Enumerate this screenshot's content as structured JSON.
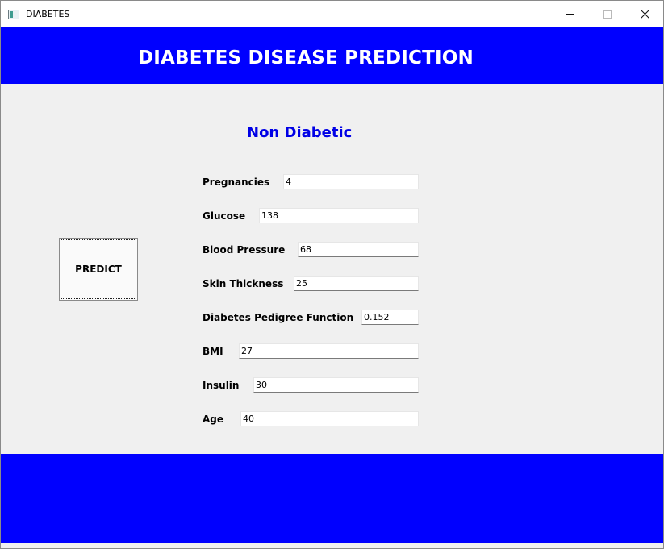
{
  "window": {
    "title": "DIABETES",
    "icon": "app-window-icon",
    "controls": {
      "minimize": "minimize-icon",
      "maximize": "maximize-icon",
      "close": "close-icon"
    }
  },
  "header": {
    "title": "DIABETES DISEASE PREDICTION",
    "band_color": "#0000ff"
  },
  "result": {
    "text": "Non Diabetic",
    "color": "#0000e6"
  },
  "predict_button": {
    "label": "PREDICT"
  },
  "fields": [
    {
      "label": "Pregnancies",
      "value": "4"
    },
    {
      "label": "Glucose",
      "value": "138"
    },
    {
      "label": "Blood Pressure",
      "value": "68"
    },
    {
      "label": "Skin Thickness",
      "value": "25"
    },
    {
      "label": "Diabetes Pedigree Function",
      "value": "0.152"
    },
    {
      "label": "BMI",
      "value": "27"
    },
    {
      "label": "Insulin",
      "value": "30"
    },
    {
      "label": "Age",
      "value": "40"
    }
  ],
  "footer": {
    "band_color": "#0000ff"
  }
}
